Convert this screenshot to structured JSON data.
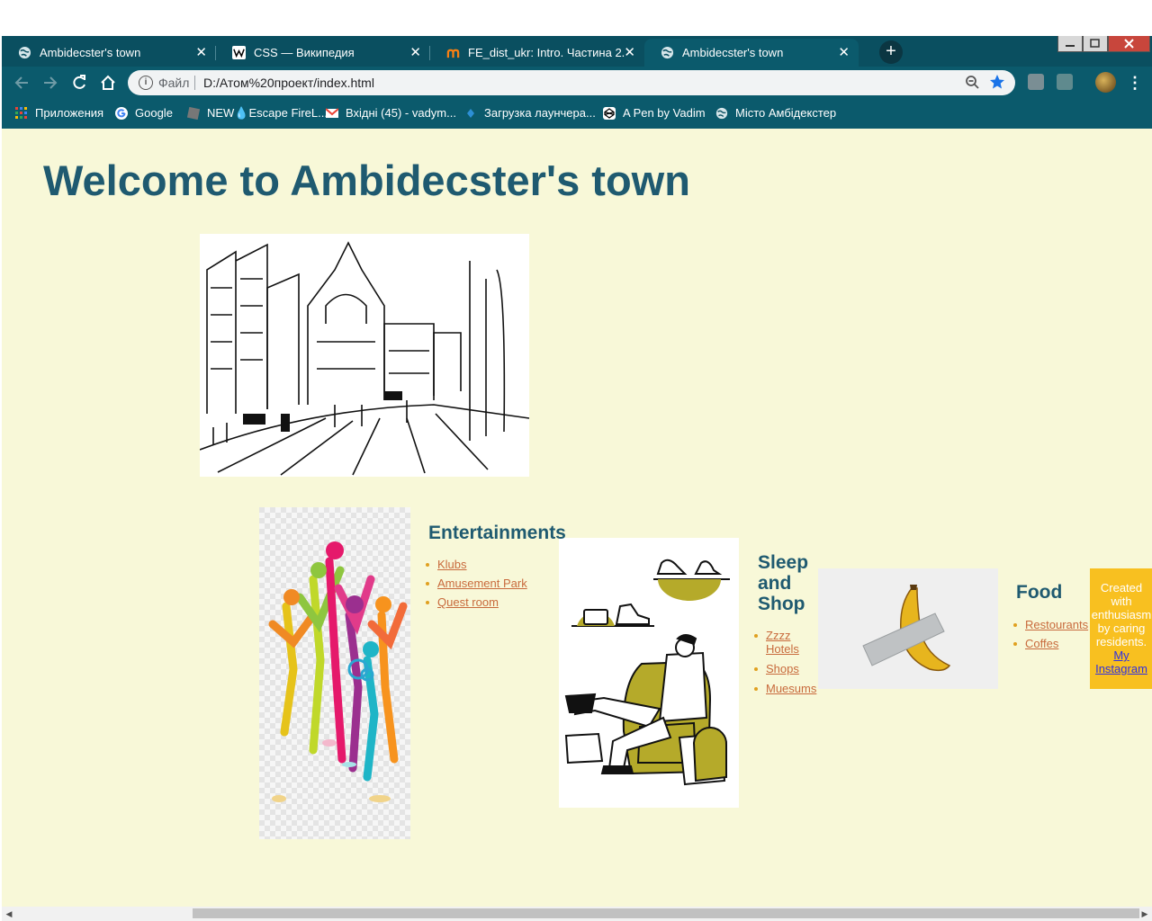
{
  "browser": {
    "tabs": [
      {
        "title": "Ambidecster's town",
        "icon": "globe-icon"
      },
      {
        "title": "CSS — Википедия",
        "icon": "wikipedia-icon"
      },
      {
        "title": "FE_dist_ukr: Intro. Частина 2.",
        "icon": "moodle-icon"
      },
      {
        "title": "Ambidecster's town",
        "icon": "globe-icon"
      }
    ],
    "new_tab": "+",
    "close_glyph": "✕",
    "address": {
      "scheme_label": "Файл",
      "url": "D:/Атом%20проект/index.html"
    },
    "bookmarks": [
      {
        "label": "Приложения",
        "icon": "apps-grid-icon"
      },
      {
        "label": "Google",
        "icon": "google-icon"
      },
      {
        "label": "NEW💧Escape FireL...",
        "icon": "game-icon"
      },
      {
        "label": "Вхідні (45) - vadym...",
        "icon": "gmail-icon"
      },
      {
        "label": "Загрузка лаунчера...",
        "icon": "diamond-icon"
      },
      {
        "label": "A Pen by Vadim",
        "icon": "codepen-icon"
      },
      {
        "label": "Місто Амбідекстер",
        "icon": "globe-icon"
      }
    ],
    "accent_color": "#0b5a6c"
  },
  "page": {
    "title": "Welcome to Ambidecster's town",
    "sections": [
      {
        "title_lines": [
          "Entertainments"
        ],
        "links": [
          [
            "Klubs"
          ],
          [
            "Amusement Park"
          ],
          [
            "Quest room"
          ]
        ]
      },
      {
        "title_lines": [
          "Sleep",
          "and",
          "Shop"
        ],
        "links": [
          [
            "Zzzz",
            "Hotels"
          ],
          [
            "Shops"
          ],
          [
            "Muesums"
          ]
        ]
      },
      {
        "title_lines": [
          "Food"
        ],
        "links": [
          [
            "Restourants"
          ],
          [
            "Coffes"
          ]
        ]
      }
    ],
    "footer_badge": {
      "lines": [
        "Created",
        "with",
        "enthusiasm",
        "by caring",
        "residents."
      ],
      "link_lines": [
        "My",
        "Instagram"
      ]
    },
    "colors": {
      "background": "#f8f8d8",
      "heading": "#1f5a70",
      "link": "#c86a3c",
      "badge": "#f8c020"
    }
  }
}
